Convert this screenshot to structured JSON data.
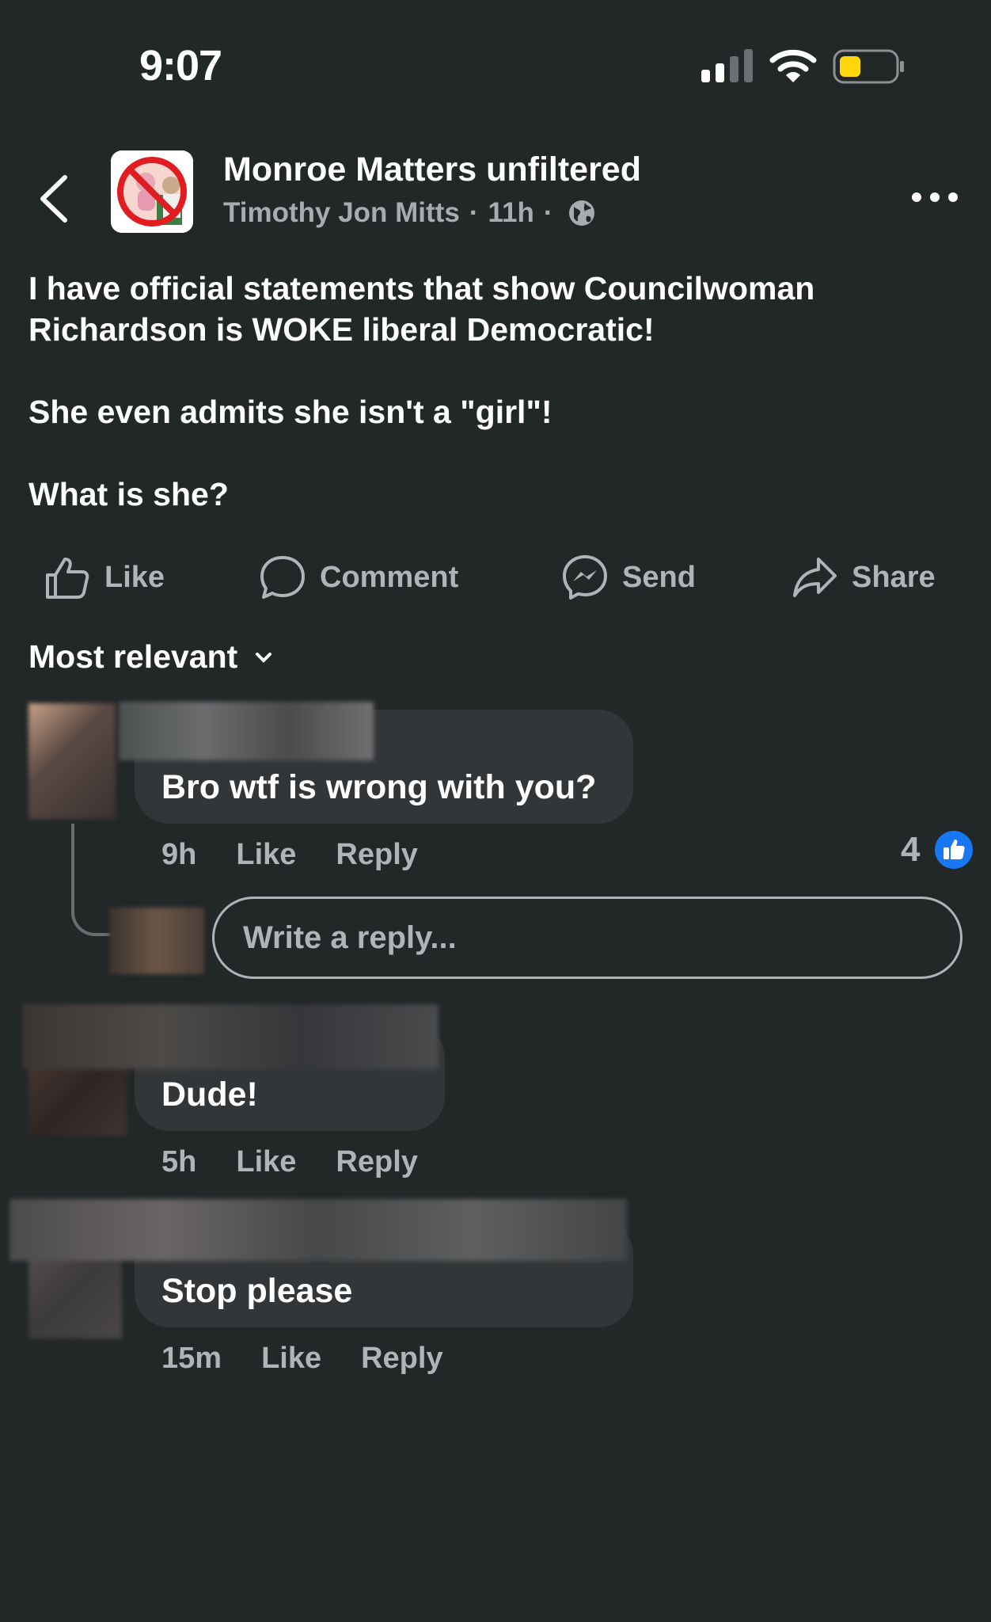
{
  "status_bar": {
    "time": "9:07",
    "battery_color": "#ffd60a"
  },
  "header": {
    "group_name": "Monroe Matters unfiltered",
    "author": "Timothy Jon Mitts",
    "separator": "·",
    "age": "11h",
    "audience_icon": "globe-icon"
  },
  "post": {
    "lines": [
      "I have official statements that show Councilwoman Richardson is WOKE liberal Democratic!",
      "She even admits she isn't a \"girl\"!",
      "What is she?"
    ]
  },
  "actions": {
    "like": "Like",
    "comment": "Comment",
    "send": "Send",
    "share": "Share"
  },
  "sort": {
    "label": "Most relevant"
  },
  "comments": [
    {
      "text": "Bro wtf is wrong with you?",
      "age": "9h",
      "like": "Like",
      "reply": "Reply",
      "reactions": "4"
    },
    {
      "text": "Dude!",
      "age": "5h",
      "like": "Like",
      "reply": "Reply"
    },
    {
      "text": "Stop please",
      "age": "15m",
      "like": "Like",
      "reply": "Reply"
    }
  ],
  "reply_box": {
    "placeholder": "Write a reply..."
  },
  "colors": {
    "background": "#222728",
    "bubble": "#333638",
    "accent": "#1877f2"
  }
}
